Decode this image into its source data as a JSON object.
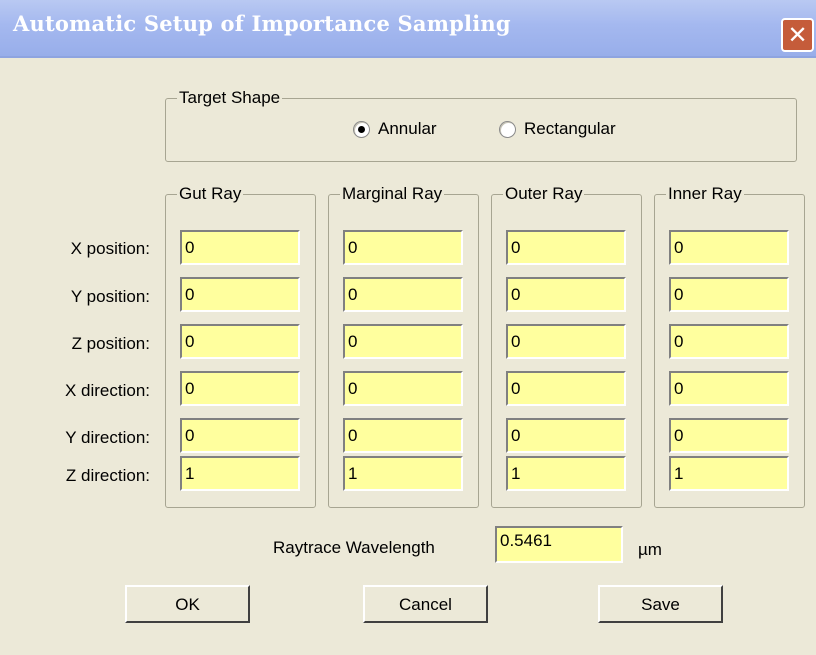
{
  "window": {
    "title": "Automatic Setup of Importance Sampling"
  },
  "target_shape": {
    "label": "Target Shape",
    "options": [
      {
        "label": "Annular",
        "checked": true
      },
      {
        "label": "Rectangular",
        "checked": false
      }
    ]
  },
  "columns": [
    "Gut Ray",
    "Marginal Ray",
    "Outer Ray",
    "Inner Ray"
  ],
  "rows": [
    "X position:",
    "Y position:",
    "Z position:",
    "X direction:",
    "Y direction:",
    "Z direction:"
  ],
  "values": [
    [
      "0",
      "0",
      "0",
      "0"
    ],
    [
      "0",
      "0",
      "0",
      "0"
    ],
    [
      "0",
      "0",
      "0",
      "0"
    ],
    [
      "0",
      "0",
      "0",
      "0"
    ],
    [
      "0",
      "0",
      "0",
      "0"
    ],
    [
      "1",
      "1",
      "1",
      "1"
    ]
  ],
  "wavelength": {
    "label": "Raytrace Wavelength",
    "value": "0.5461",
    "unit": "µm"
  },
  "buttons": {
    "ok": "OK",
    "cancel": "Cancel",
    "save": "Save"
  },
  "colors": {
    "input_bg": "#ffff9e",
    "dialog_bg": "#ece9d8",
    "title_bar": "#a4b8ef"
  },
  "icons": {
    "close": "close-icon"
  }
}
